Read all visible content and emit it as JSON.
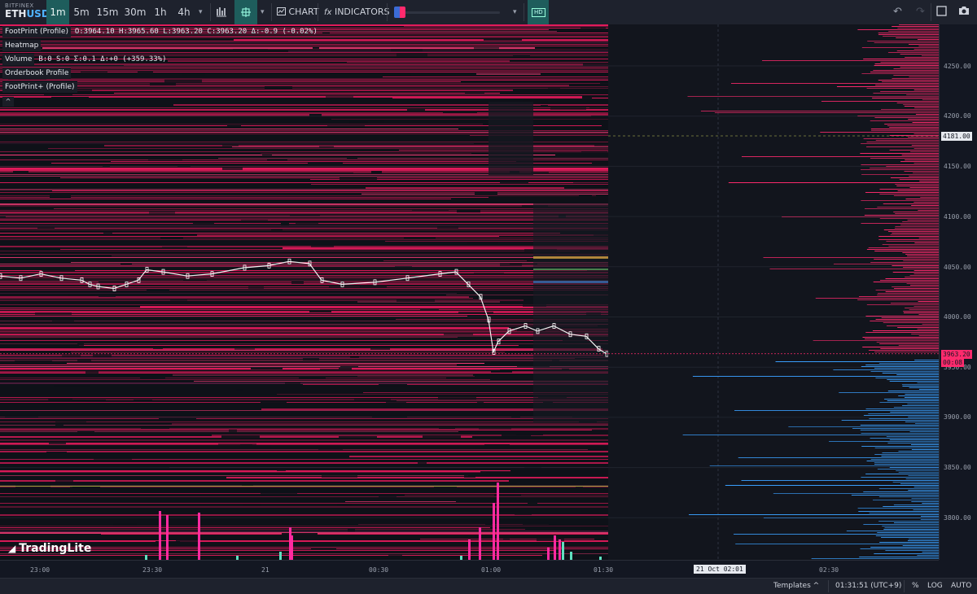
{
  "symbol": {
    "exchange": "BITFINEX",
    "base": "ETH",
    "quote": "USD"
  },
  "timeframes": [
    {
      "label": "1m",
      "active": true
    },
    {
      "label": "5m",
      "active": false
    },
    {
      "label": "15m",
      "active": false
    },
    {
      "label": "30m",
      "active": false
    },
    {
      "label": "1h",
      "active": false
    },
    {
      "label": "4h",
      "active": false
    }
  ],
  "toolbar": {
    "chart_label": "CHART",
    "indicators_label": "INDICATORS",
    "hd_label": "HD",
    "fx_label": "fx"
  },
  "legend": {
    "footprint_title": "FootPrint (Profile)",
    "footprint_values": "O:3964.10 H:3965.60 L:3963.20 C:3963.20 Δ:-0.9 (-0.02%)",
    "heatmap_title": "Heatmap",
    "volume_title": "Volume",
    "volume_values": "B:0 S:0 Σ:0.1 Δ:+0 (+359.33%)",
    "orderbook_title": "Orderbook Profile",
    "footprint_plus_title": "FootPrint+ (Profile)"
  },
  "price_axis": {
    "labels": [
      "4250.00",
      "4200.00",
      "4150.00",
      "4100.00",
      "4050.00",
      "4000.00",
      "3950.00",
      "3900.00",
      "3850.00",
      "3800.00"
    ],
    "crosshair_price": "4181.00",
    "last_price": "3963.20",
    "countdown": "00:08"
  },
  "time_axis": {
    "labels": [
      "23:00",
      "23:30",
      "21",
      "00:30",
      "01:00",
      "01:30",
      "02:30"
    ],
    "crosshair_time": "21 Oct 02:01"
  },
  "statusbar": {
    "templates": "Templates",
    "clock": "01:31:51 (UTC+9)",
    "percent": "%",
    "log": "LOG",
    "auto": "AUTO"
  },
  "watermark": "TradingLite",
  "colors": {
    "accent": "#1e5d5c",
    "bid": "#3aa0ff",
    "ask": "#ff2a6d",
    "heat": "#e01a5a"
  },
  "chart_data": {
    "type": "heatmap",
    "price_range": [
      3765,
      4280
    ],
    "candles_close_path": [
      [
        0,
        4038
      ],
      [
        25,
        4036
      ],
      [
        50,
        4040
      ],
      [
        75,
        4036
      ],
      [
        100,
        4034
      ],
      [
        110,
        4030
      ],
      [
        120,
        4028
      ],
      [
        140,
        4026
      ],
      [
        155,
        4030
      ],
      [
        170,
        4034
      ],
      [
        180,
        4044
      ],
      [
        200,
        4042
      ],
      [
        230,
        4038
      ],
      [
        260,
        4040
      ],
      [
        300,
        4046
      ],
      [
        330,
        4048
      ],
      [
        355,
        4052
      ],
      [
        380,
        4050
      ],
      [
        395,
        4034
      ],
      [
        420,
        4030
      ],
      [
        460,
        4032
      ],
      [
        500,
        4036
      ],
      [
        540,
        4040
      ],
      [
        560,
        4042
      ],
      [
        575,
        4030
      ],
      [
        590,
        4018
      ],
      [
        600,
        3996
      ],
      [
        606,
        3965
      ],
      [
        612,
        3975
      ],
      [
        625,
        3985
      ],
      [
        645,
        3990
      ],
      [
        660,
        3985
      ],
      [
        680,
        3990
      ],
      [
        700,
        3982
      ],
      [
        720,
        3980
      ],
      [
        735,
        3968
      ],
      [
        745,
        3963
      ]
    ],
    "orderbook_bids_max": 3958,
    "orderbook_asks_min": 3964
  }
}
